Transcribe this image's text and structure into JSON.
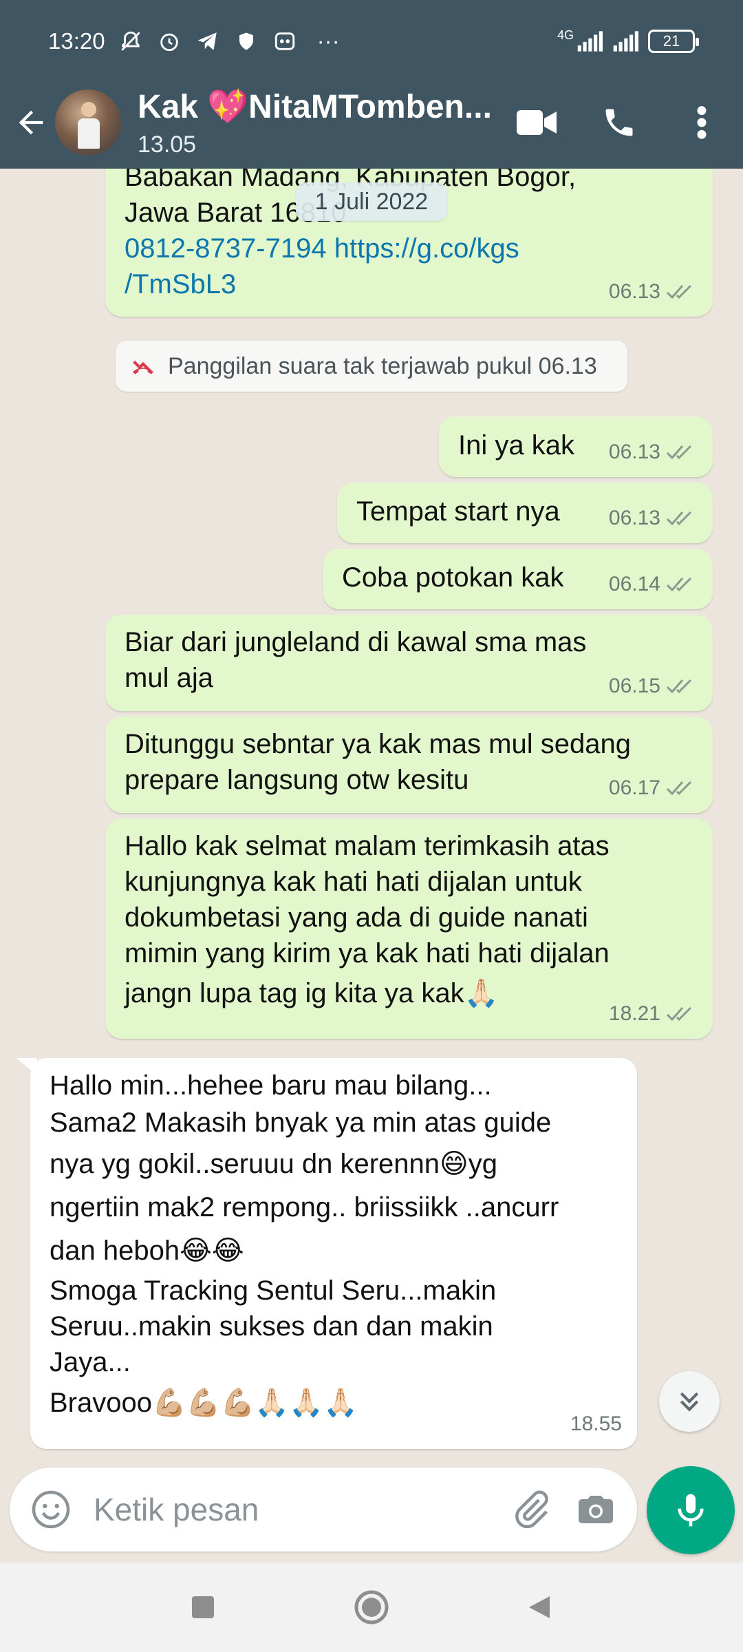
{
  "status": {
    "time": "13:20",
    "more": "···",
    "network": "4G",
    "battery": "21"
  },
  "appbar": {
    "contact_name": "Kak 💖NitaMTomben...",
    "last_seen": "13.05"
  },
  "chat": {
    "date_chip": "1 Juli 2022",
    "messages": [
      {
        "dir": "out",
        "lines": [
          "Babakan Madang, Kabupaten Bogor,",
          "Jawa Barat 16810"
        ],
        "link_lines": [
          "0812-8737-7194 https://g.co/kgs",
          "/TmSbL3"
        ],
        "time": "06.13",
        "status": "read"
      },
      {
        "dir": "out",
        "text": "Ini ya kak",
        "time": "06.13",
        "status": "read"
      },
      {
        "dir": "out",
        "text": "Tempat start nya",
        "time": "06.13",
        "status": "read"
      },
      {
        "dir": "out",
        "text": "Coba potokan kak",
        "time": "06.14",
        "status": "read"
      },
      {
        "dir": "out",
        "lines": [
          "Biar dari jungleland di kawal sma mas",
          "mul aja"
        ],
        "time": "06.15",
        "status": "read"
      },
      {
        "dir": "out",
        "lines": [
          "Ditunggu sebntar ya kak mas mul sedang",
          "prepare langsung otw kesitu"
        ],
        "time": "06.17",
        "status": "read"
      },
      {
        "dir": "out",
        "lines": [
          "Hallo kak selmat malam terimkasih atas",
          "kunjungnya kak hati hati dijalan untuk",
          "dokumbetasi yang ada di guide nanati",
          "mimin yang kirim ya kak hati hati dijalan",
          "jangn lupa tag ig kita ya kak🙏🏻"
        ],
        "time": "18.21",
        "status": "read"
      },
      {
        "dir": "in",
        "lines": [
          "Hallo min...hehee baru mau bilang...",
          "Sama2 Makasih bnyak ya min atas guide",
          "nya yg gokil..seruuu dn kerennn😄yg",
          "ngertiin mak2 rempong.. briissiikk ..ancurr",
          "dan heboh😂😂",
          "Smoga Tracking Sentul Seru...makin",
          "Seruu..makin sukses dan dan makin",
          "Jaya...",
          "Bravooo💪🏼💪🏼💪🏼🙏🏻🙏🏻🙏🏻"
        ],
        "time": "18.55"
      }
    ],
    "system_call": "Panggilan suara tak terjawab pukul 06.13"
  },
  "input": {
    "placeholder": "Ketik pesan",
    "value": ""
  },
  "colors": {
    "header": "#3f5561",
    "outgoing": "#e2f7cb",
    "incoming": "#ffffff",
    "accent": "#00a884",
    "link": "#0b77ae"
  }
}
